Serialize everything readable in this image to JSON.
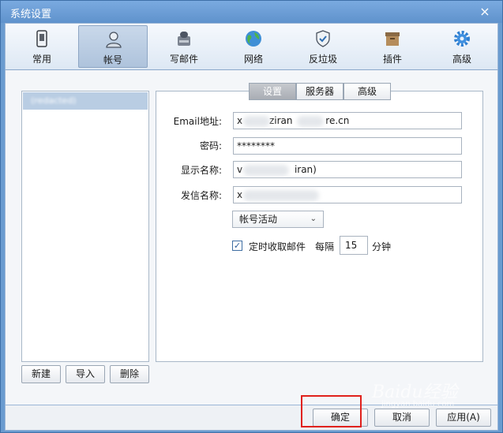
{
  "window": {
    "title": "系统设置",
    "close_symbol": "×"
  },
  "toolbar": {
    "items": [
      {
        "label": "常用",
        "icon": "settings-phone-icon",
        "active": false
      },
      {
        "label": "帐号",
        "icon": "user-icon",
        "active": true
      },
      {
        "label": "写邮件",
        "icon": "compose-icon",
        "active": false
      },
      {
        "label": "网络",
        "icon": "globe-icon",
        "active": false
      },
      {
        "label": "反垃圾",
        "icon": "shield-icon",
        "active": false
      },
      {
        "label": "插件",
        "icon": "plugin-box-icon",
        "active": false
      },
      {
        "label": "高级",
        "icon": "gear-icon",
        "active": false
      }
    ]
  },
  "accounts": {
    "selected_name": "(redacted)",
    "buttons": {
      "new": "新建",
      "import": "导入",
      "delete": "删除"
    }
  },
  "tabs": [
    {
      "label": "设置",
      "active": true
    },
    {
      "label": "服务器",
      "active": false
    },
    {
      "label": "高级",
      "active": false
    }
  ],
  "form": {
    "email_label": "Email地址:",
    "email_value_prefix": "x",
    "email_value_mid": "ziran",
    "email_value_suffix": "re.cn",
    "password_label": "密码:",
    "password_value": "********",
    "display_name_label": "显示名称:",
    "display_name_prefix": "v",
    "display_name_suffix": "iran)",
    "sender_name_label": "发信名称:",
    "sender_name_prefix": "x",
    "status_select": "帐号活动",
    "chevron": "⌄",
    "schedule_check_label": "定时收取邮件",
    "interval_prefix": "每隔",
    "interval_value": "15",
    "interval_unit": "分钟",
    "checkmark": "✓"
  },
  "footer": {
    "ok": "确定",
    "cancel": "取消",
    "apply": "应用(A)"
  },
  "watermark": {
    "text": "Baidu经验",
    "sub": "jingyan.baidu.com"
  },
  "colors": {
    "title_bar": "#6a9bd0",
    "highlight": "#e0211c",
    "selected_account": "#b9cde3"
  }
}
